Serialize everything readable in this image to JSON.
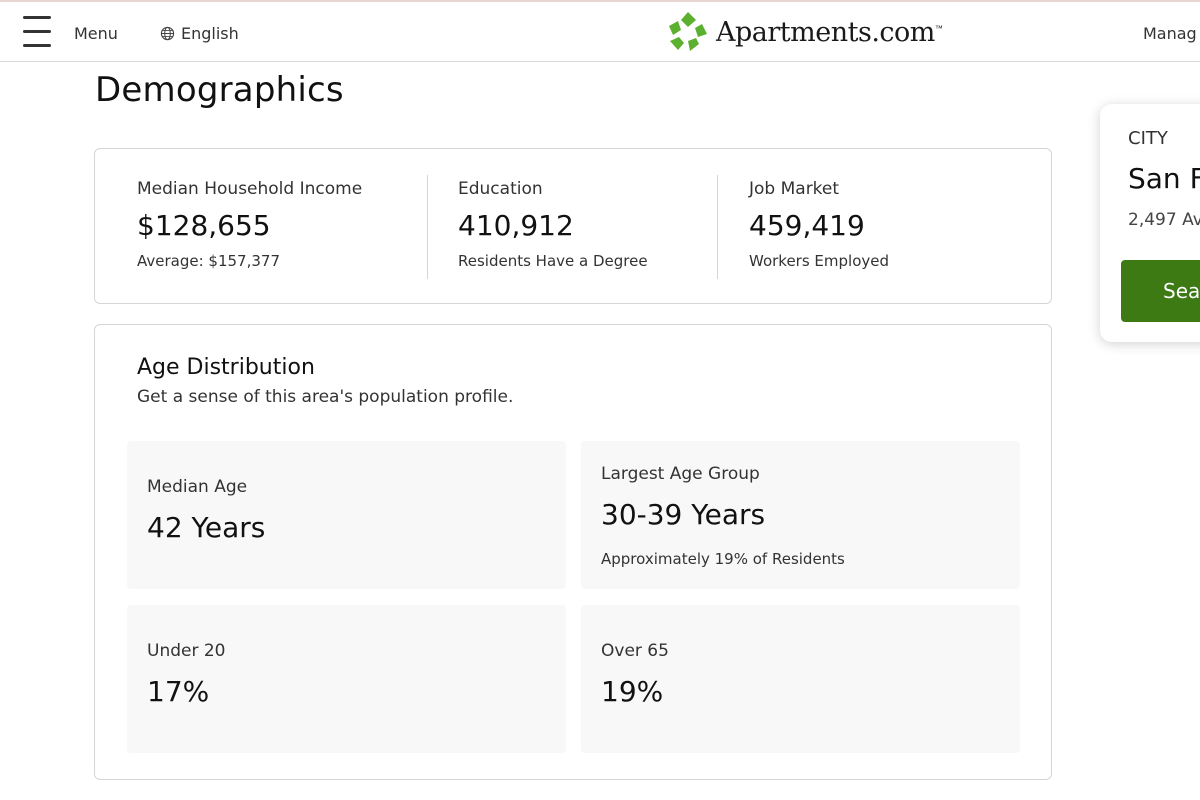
{
  "header": {
    "menu_label": "Menu",
    "language_label": "English",
    "logo_text": "Apartments.com",
    "logo_tm": "™",
    "manage_label": "Manag"
  },
  "page": {
    "title": "Demographics"
  },
  "stats": [
    {
      "label": "Median Household Income",
      "value": "$128,655",
      "sub": "Average: $157,377"
    },
    {
      "label": "Education",
      "value": "410,912",
      "sub": "Residents Have a Degree"
    },
    {
      "label": "Job Market",
      "value": "459,419",
      "sub": "Workers Employed"
    }
  ],
  "age_distribution": {
    "title": "Age Distribution",
    "subtitle": "Get a sense of this area's population profile.",
    "tiles": [
      {
        "label": "Median Age",
        "value": "42 Years"
      },
      {
        "label": "Largest Age Group",
        "value": "30-39 Years",
        "sub": "Approximately 19% of Residents"
      },
      {
        "label": "Under 20",
        "value": "17%"
      },
      {
        "label": "Over 65",
        "value": "19%"
      }
    ]
  },
  "city_card": {
    "eyebrow": "CITY",
    "name": "San F",
    "count": "2,497 Av",
    "button_label": "Sea"
  },
  "colors": {
    "brand_green": "#3d7a14",
    "logo_green": "#5cb030"
  },
  "icons": {
    "menu": "hamburger-icon",
    "language": "globe-icon",
    "logo": "apartments-logo-icon"
  }
}
